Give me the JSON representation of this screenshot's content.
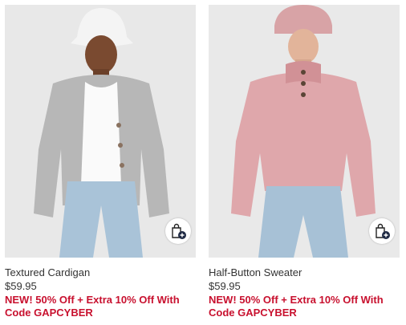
{
  "products": [
    {
      "name": "Textured Cardigan",
      "price": "$59.95",
      "promo": "NEW! 50% Off + Extra 10% Off With Code GAPCYBER",
      "image_icon": "product-photo-gray-cardigan",
      "bag_icon": "add-to-bag-icon"
    },
    {
      "name": "Half-Button Sweater",
      "price": "$59.95",
      "promo": "NEW! 50% Off + Extra 10% Off With Code GAPCYBER",
      "image_icon": "product-photo-pink-sweater",
      "bag_icon": "add-to-bag-icon"
    }
  ],
  "colors": {
    "promo": "#c8102e",
    "text": "#333333",
    "bag_badge": "#1f2a44",
    "photo_bg": "#e6e6e6"
  }
}
